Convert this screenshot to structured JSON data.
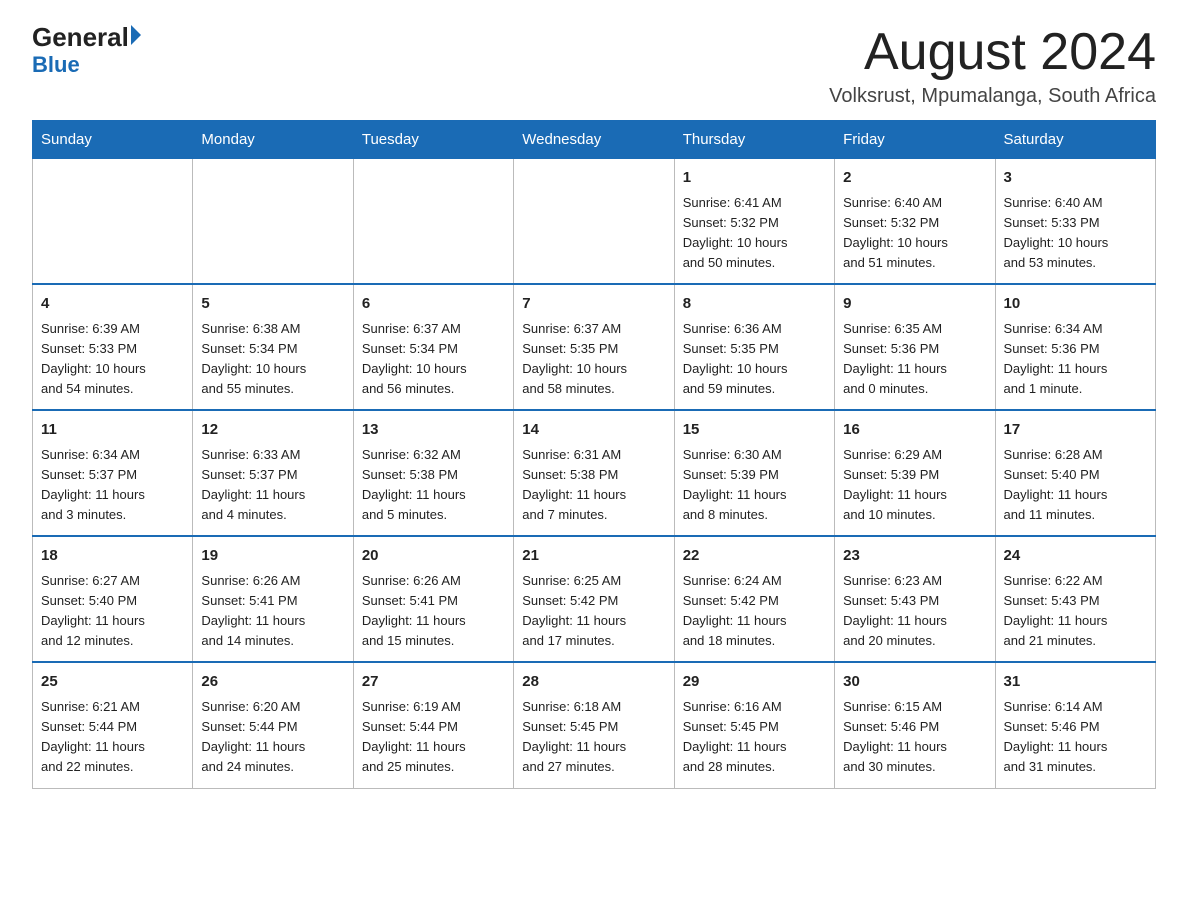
{
  "logo": {
    "general": "General",
    "blue": "Blue"
  },
  "header": {
    "month": "August 2024",
    "location": "Volksrust, Mpumalanga, South Africa"
  },
  "weekdays": [
    "Sunday",
    "Monday",
    "Tuesday",
    "Wednesday",
    "Thursday",
    "Friday",
    "Saturday"
  ],
  "weeks": [
    [
      {
        "day": "",
        "info": ""
      },
      {
        "day": "",
        "info": ""
      },
      {
        "day": "",
        "info": ""
      },
      {
        "day": "",
        "info": ""
      },
      {
        "day": "1",
        "info": "Sunrise: 6:41 AM\nSunset: 5:32 PM\nDaylight: 10 hours\nand 50 minutes."
      },
      {
        "day": "2",
        "info": "Sunrise: 6:40 AM\nSunset: 5:32 PM\nDaylight: 10 hours\nand 51 minutes."
      },
      {
        "day": "3",
        "info": "Sunrise: 6:40 AM\nSunset: 5:33 PM\nDaylight: 10 hours\nand 53 minutes."
      }
    ],
    [
      {
        "day": "4",
        "info": "Sunrise: 6:39 AM\nSunset: 5:33 PM\nDaylight: 10 hours\nand 54 minutes."
      },
      {
        "day": "5",
        "info": "Sunrise: 6:38 AM\nSunset: 5:34 PM\nDaylight: 10 hours\nand 55 minutes."
      },
      {
        "day": "6",
        "info": "Sunrise: 6:37 AM\nSunset: 5:34 PM\nDaylight: 10 hours\nand 56 minutes."
      },
      {
        "day": "7",
        "info": "Sunrise: 6:37 AM\nSunset: 5:35 PM\nDaylight: 10 hours\nand 58 minutes."
      },
      {
        "day": "8",
        "info": "Sunrise: 6:36 AM\nSunset: 5:35 PM\nDaylight: 10 hours\nand 59 minutes."
      },
      {
        "day": "9",
        "info": "Sunrise: 6:35 AM\nSunset: 5:36 PM\nDaylight: 11 hours\nand 0 minutes."
      },
      {
        "day": "10",
        "info": "Sunrise: 6:34 AM\nSunset: 5:36 PM\nDaylight: 11 hours\nand 1 minute."
      }
    ],
    [
      {
        "day": "11",
        "info": "Sunrise: 6:34 AM\nSunset: 5:37 PM\nDaylight: 11 hours\nand 3 minutes."
      },
      {
        "day": "12",
        "info": "Sunrise: 6:33 AM\nSunset: 5:37 PM\nDaylight: 11 hours\nand 4 minutes."
      },
      {
        "day": "13",
        "info": "Sunrise: 6:32 AM\nSunset: 5:38 PM\nDaylight: 11 hours\nand 5 minutes."
      },
      {
        "day": "14",
        "info": "Sunrise: 6:31 AM\nSunset: 5:38 PM\nDaylight: 11 hours\nand 7 minutes."
      },
      {
        "day": "15",
        "info": "Sunrise: 6:30 AM\nSunset: 5:39 PM\nDaylight: 11 hours\nand 8 minutes."
      },
      {
        "day": "16",
        "info": "Sunrise: 6:29 AM\nSunset: 5:39 PM\nDaylight: 11 hours\nand 10 minutes."
      },
      {
        "day": "17",
        "info": "Sunrise: 6:28 AM\nSunset: 5:40 PM\nDaylight: 11 hours\nand 11 minutes."
      }
    ],
    [
      {
        "day": "18",
        "info": "Sunrise: 6:27 AM\nSunset: 5:40 PM\nDaylight: 11 hours\nand 12 minutes."
      },
      {
        "day": "19",
        "info": "Sunrise: 6:26 AM\nSunset: 5:41 PM\nDaylight: 11 hours\nand 14 minutes."
      },
      {
        "day": "20",
        "info": "Sunrise: 6:26 AM\nSunset: 5:41 PM\nDaylight: 11 hours\nand 15 minutes."
      },
      {
        "day": "21",
        "info": "Sunrise: 6:25 AM\nSunset: 5:42 PM\nDaylight: 11 hours\nand 17 minutes."
      },
      {
        "day": "22",
        "info": "Sunrise: 6:24 AM\nSunset: 5:42 PM\nDaylight: 11 hours\nand 18 minutes."
      },
      {
        "day": "23",
        "info": "Sunrise: 6:23 AM\nSunset: 5:43 PM\nDaylight: 11 hours\nand 20 minutes."
      },
      {
        "day": "24",
        "info": "Sunrise: 6:22 AM\nSunset: 5:43 PM\nDaylight: 11 hours\nand 21 minutes."
      }
    ],
    [
      {
        "day": "25",
        "info": "Sunrise: 6:21 AM\nSunset: 5:44 PM\nDaylight: 11 hours\nand 22 minutes."
      },
      {
        "day": "26",
        "info": "Sunrise: 6:20 AM\nSunset: 5:44 PM\nDaylight: 11 hours\nand 24 minutes."
      },
      {
        "day": "27",
        "info": "Sunrise: 6:19 AM\nSunset: 5:44 PM\nDaylight: 11 hours\nand 25 minutes."
      },
      {
        "day": "28",
        "info": "Sunrise: 6:18 AM\nSunset: 5:45 PM\nDaylight: 11 hours\nand 27 minutes."
      },
      {
        "day": "29",
        "info": "Sunrise: 6:16 AM\nSunset: 5:45 PM\nDaylight: 11 hours\nand 28 minutes."
      },
      {
        "day": "30",
        "info": "Sunrise: 6:15 AM\nSunset: 5:46 PM\nDaylight: 11 hours\nand 30 minutes."
      },
      {
        "day": "31",
        "info": "Sunrise: 6:14 AM\nSunset: 5:46 PM\nDaylight: 11 hours\nand 31 minutes."
      }
    ]
  ]
}
